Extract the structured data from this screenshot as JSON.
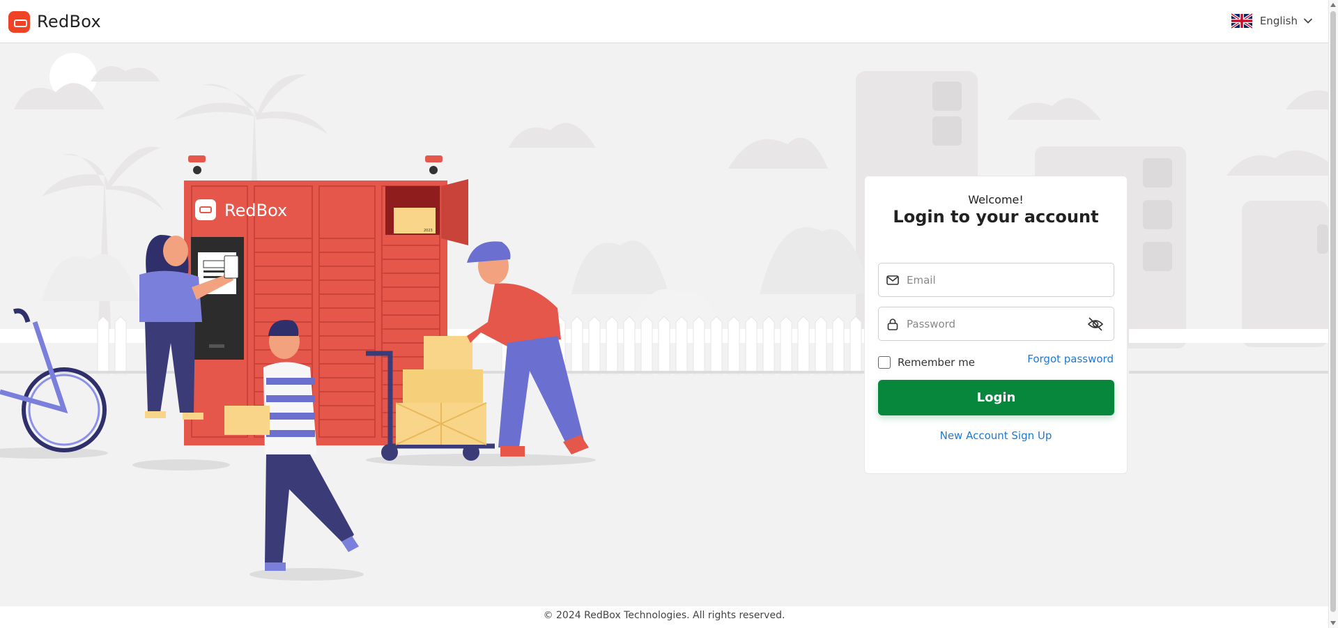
{
  "header": {
    "brand": "RedBox",
    "language": "English",
    "language_flag": "uk-flag-icon"
  },
  "illustration": {
    "locker_brand": "RedBox",
    "box_label": "2023"
  },
  "login": {
    "welcome": "Welcome!",
    "title": "Login to your account",
    "email_placeholder": "Email",
    "password_placeholder": "Password",
    "remember_me": "Remember me",
    "forgot_password": "Forgot password",
    "login_button": "Login",
    "signup_link": "New Account Sign Up"
  },
  "footer": {
    "copyright": "© 2024 RedBox Technologies. All rights reserved."
  },
  "colors": {
    "brand_red": "#ef4326",
    "primary_green": "#06873c",
    "link_blue": "#1f78d1",
    "background": "#f2f2f2"
  }
}
